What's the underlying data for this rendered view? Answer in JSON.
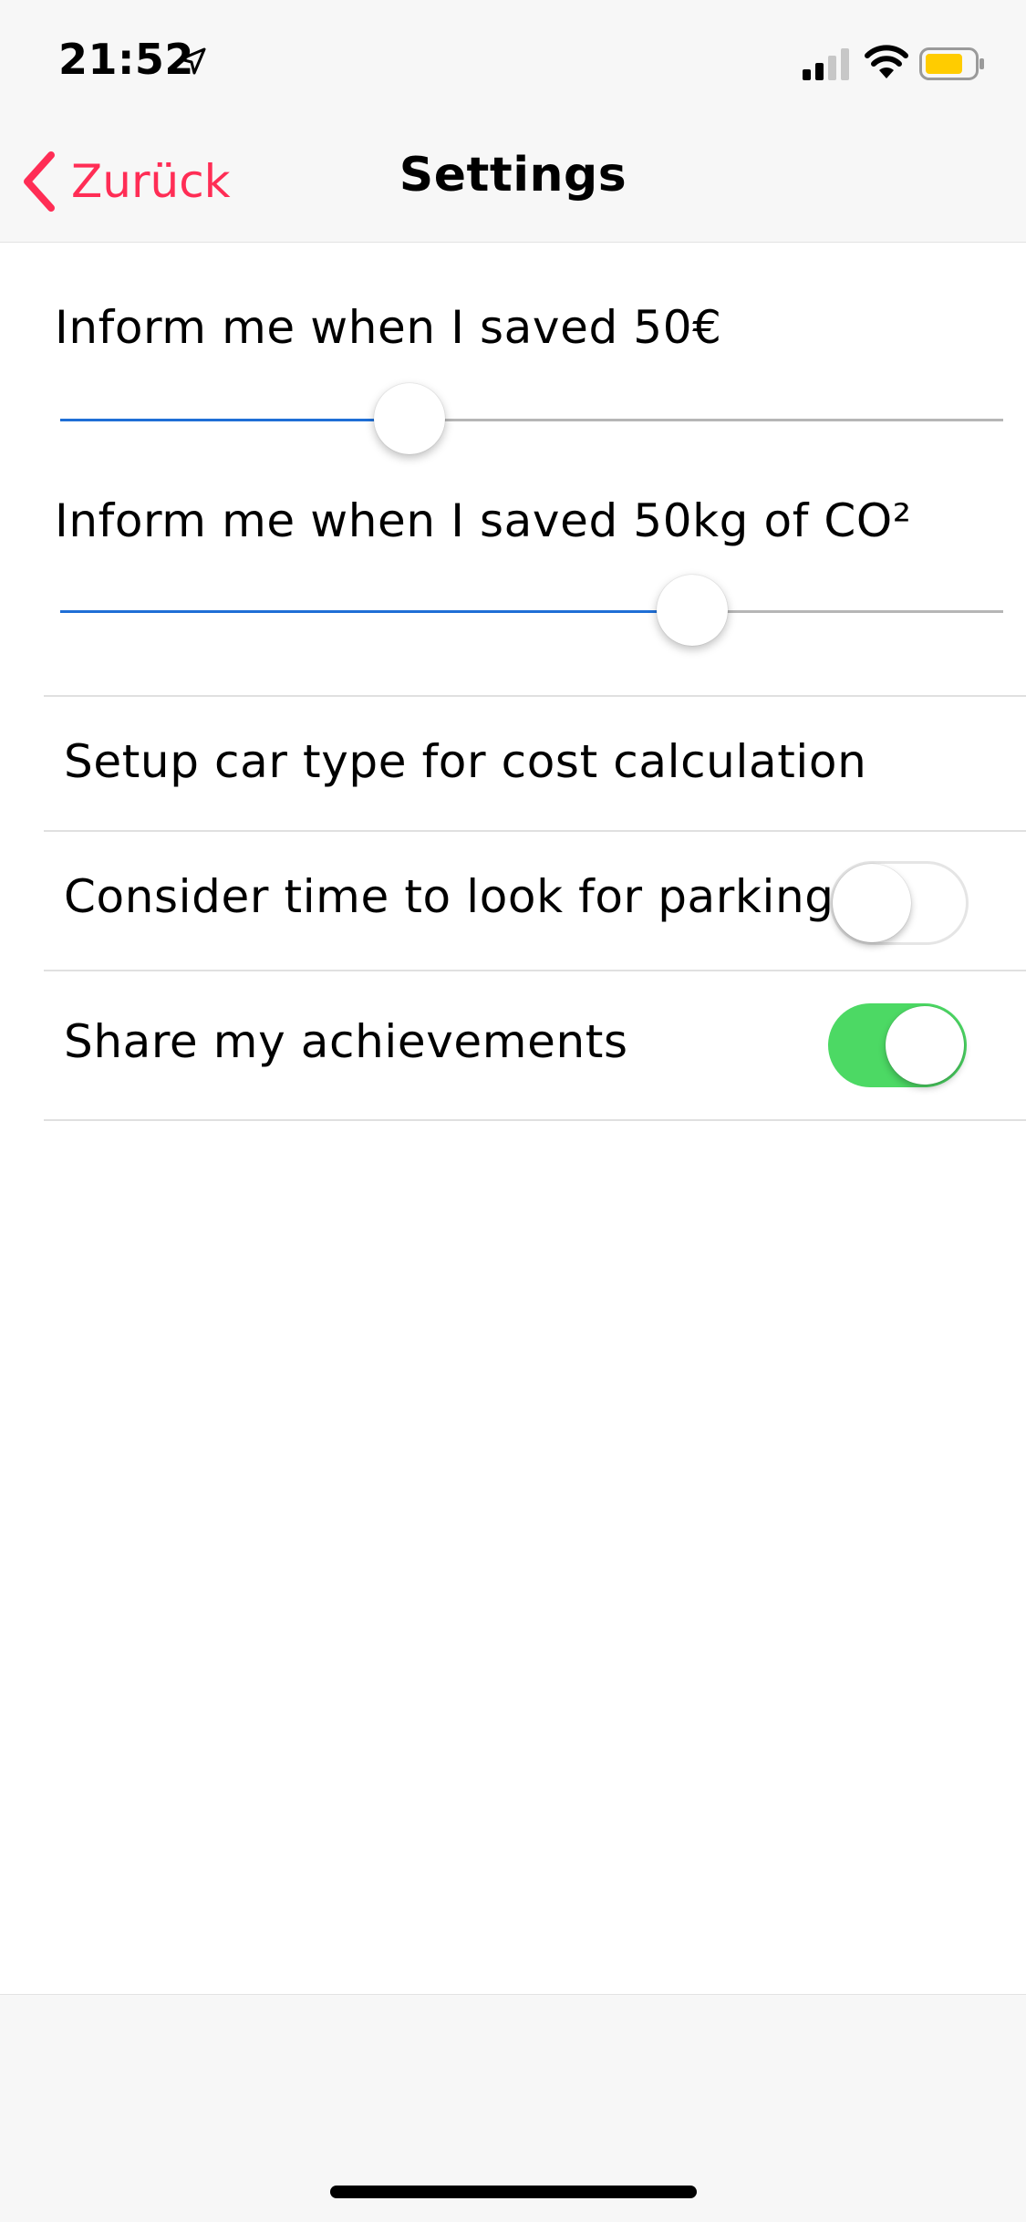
{
  "status_bar": {
    "time": "21:52"
  },
  "nav": {
    "back_label": "Zurück",
    "title": "Settings"
  },
  "sliders": [
    {
      "label": "Inform me when I saved 50€",
      "value_fraction": 0.37
    },
    {
      "label": "Inform me when I saved 50kg of CO²",
      "value_fraction": 0.67
    }
  ],
  "rows": {
    "car_type": "Setup car type for cost calculation",
    "parking": {
      "label": "Consider time to look for parking",
      "enabled": false
    },
    "share": {
      "label": "Share my achievements",
      "enabled": true
    }
  },
  "colors": {
    "accent": "#ff2d55",
    "slider_fill": "#1f6fd6",
    "toggle_on": "#4cd964"
  },
  "icons": [
    "location-arrow-icon",
    "signal-icon",
    "wifi-icon",
    "battery-icon",
    "chevron-left-icon"
  ]
}
